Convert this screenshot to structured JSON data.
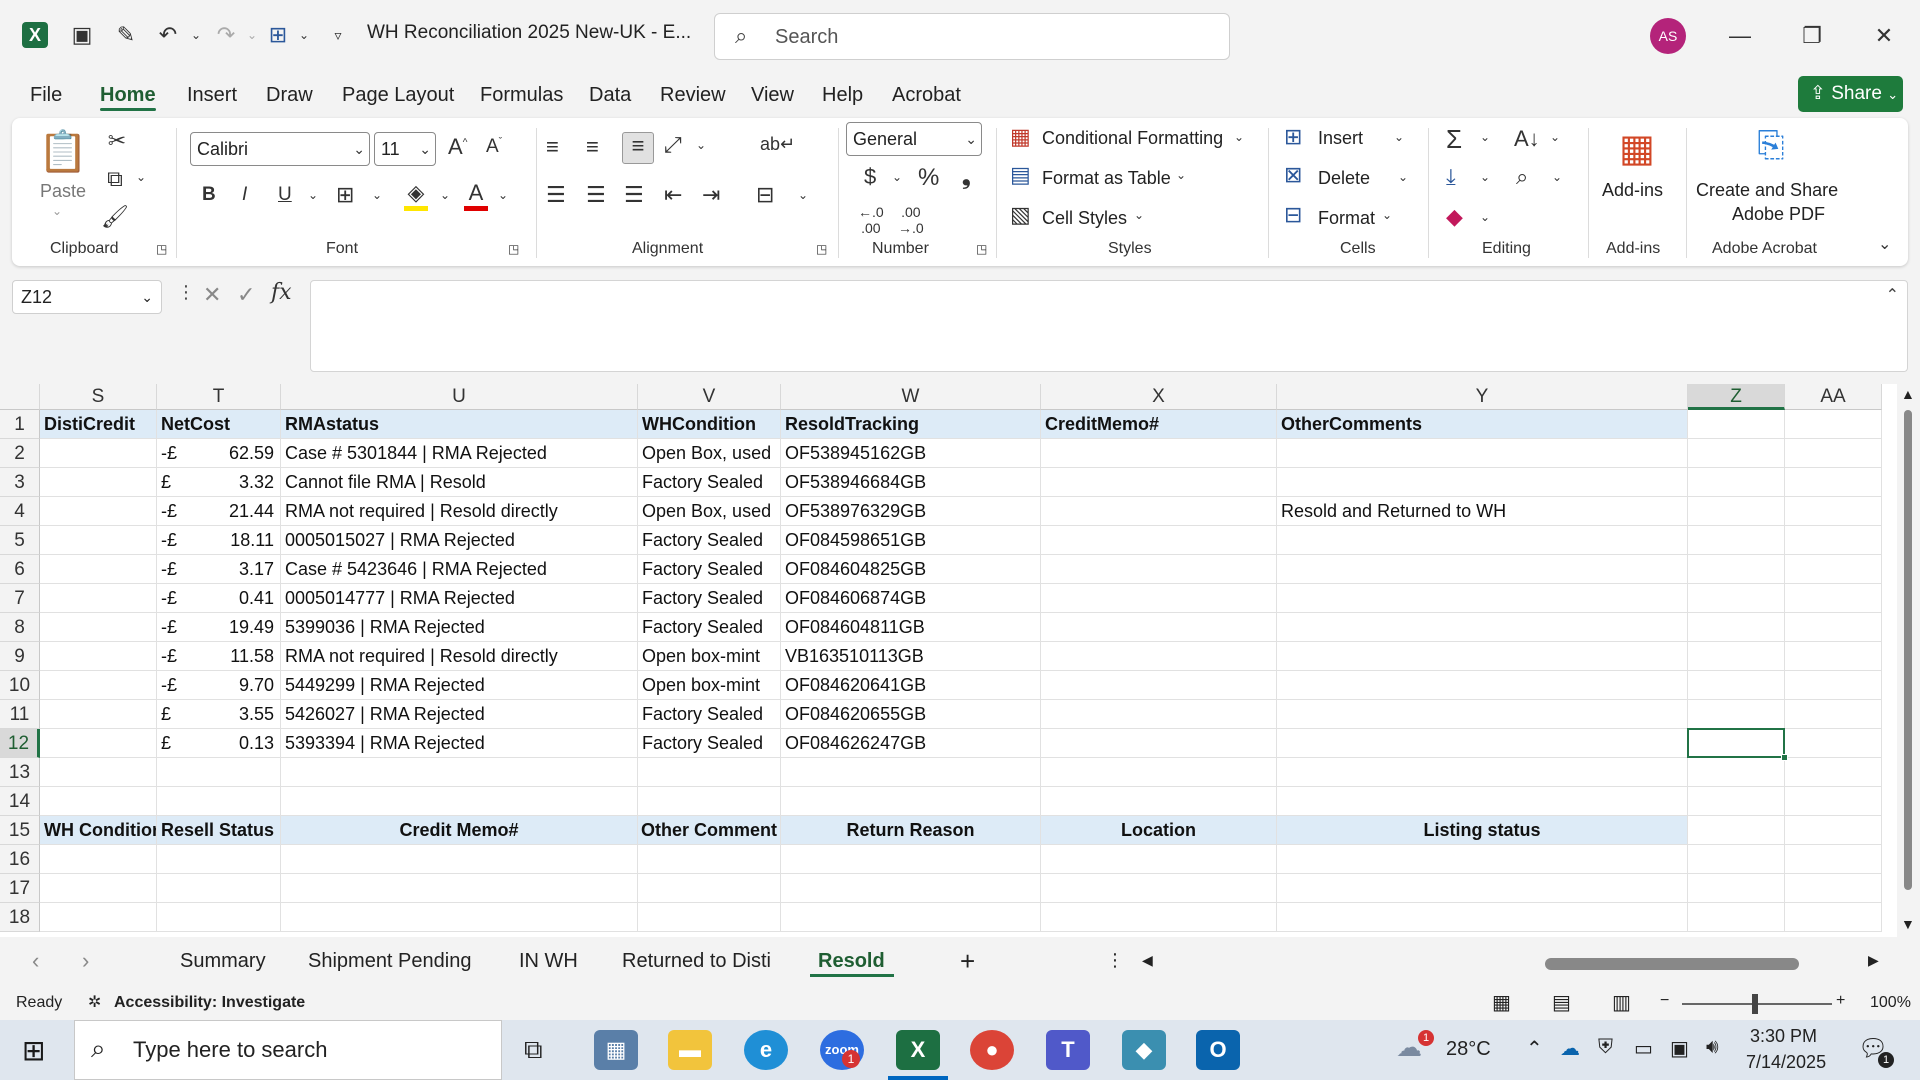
{
  "title_bar": {
    "document_title": "WH Reconciliation 2025 New-UK  -  E...",
    "search_placeholder": "Search",
    "user_initials": "AS"
  },
  "menu": {
    "items": [
      "File",
      "Home",
      "Insert",
      "Draw",
      "Page Layout",
      "Formulas",
      "Data",
      "Review",
      "View",
      "Help",
      "Acrobat"
    ],
    "active": "Home",
    "share_label": "Share"
  },
  "ribbon": {
    "clipboard": {
      "label": "Clipboard",
      "paste": "Paste"
    },
    "font": {
      "label": "Font",
      "font_name": "Calibri",
      "font_size": "11"
    },
    "alignment": {
      "label": "Alignment"
    },
    "number": {
      "label": "Number",
      "format": "General"
    },
    "styles": {
      "label": "Styles",
      "conditional": "Conditional Formatting",
      "format_table": "Format as Table",
      "cell_styles": "Cell Styles"
    },
    "cells": {
      "label": "Cells",
      "insert": "Insert",
      "delete": "Delete",
      "format": "Format"
    },
    "editing": {
      "label": "Editing"
    },
    "addins": {
      "label": "Add-ins",
      "button": "Add-ins"
    },
    "acrobat": {
      "label": "Adobe Acrobat",
      "button_line1": "Create and Share",
      "button_line2": "Adobe PDF"
    }
  },
  "formula_bar": {
    "name_box": "Z12",
    "fx": "fx"
  },
  "grid": {
    "columns": [
      "S",
      "T",
      "U",
      "V",
      "W",
      "X",
      "Y",
      "Z",
      "AA"
    ],
    "selected_column": "Z",
    "selected_row": "12",
    "header_row": [
      "DistiCredit",
      "NetCost",
      "RMAstatus",
      "WHCondition",
      "ResoldTracking",
      "CreditMemo#",
      "OtherComments"
    ],
    "rows": [
      {
        "n": "2",
        "sign": "-£",
        "amt": "62.59",
        "status": "Case # 5301844 | RMA Rejected",
        "cond": "Open Box, used",
        "track": "OF538945162GB",
        "comment": ""
      },
      {
        "n": "3",
        "sign": "£",
        "amt": "3.32",
        "status": "Cannot file RMA | Resold",
        "cond": "Factory Sealed",
        "track": "OF538946684GB",
        "comment": ""
      },
      {
        "n": "4",
        "sign": "-£",
        "amt": "21.44",
        "status": "RMA not required | Resold directly",
        "cond": "Open Box, used",
        "track": "OF538976329GB",
        "comment": "Resold and Returned to WH"
      },
      {
        "n": "5",
        "sign": "-£",
        "amt": "18.11",
        "status": "0005015027 | RMA Rejected",
        "cond": "Factory Sealed",
        "track": "OF084598651GB",
        "comment": ""
      },
      {
        "n": "6",
        "sign": "-£",
        "amt": "3.17",
        "status": "Case # 5423646 | RMA Rejected",
        "cond": "Factory Sealed",
        "track": "OF084604825GB",
        "comment": ""
      },
      {
        "n": "7",
        "sign": "-£",
        "amt": "0.41",
        "status": "0005014777 | RMA Rejected",
        "cond": "Factory Sealed",
        "track": "OF084606874GB",
        "comment": ""
      },
      {
        "n": "8",
        "sign": "-£",
        "amt": "19.49",
        "status": "5399036 | RMA Rejected",
        "cond": "Factory Sealed",
        "track": "OF084604811GB",
        "comment": ""
      },
      {
        "n": "9",
        "sign": "-£",
        "amt": "11.58",
        "status": "RMA not required | Resold directly",
        "cond": "Open box-mint",
        "track": "VB163510113GB",
        "comment": ""
      },
      {
        "n": "10",
        "sign": "-£",
        "amt": "9.70",
        "status": "5449299 | RMA Rejected",
        "cond": "Open box-mint",
        "track": "OF084620641GB",
        "comment": ""
      },
      {
        "n": "11",
        "sign": "£",
        "amt": "3.55",
        "status": "5426027 | RMA Rejected",
        "cond": "Factory Sealed",
        "track": "OF084620655GB",
        "comment": ""
      },
      {
        "n": "12",
        "sign": "£",
        "amt": "0.13",
        "status": "5393394 | RMA Rejected",
        "cond": "Factory Sealed",
        "track": "OF084626247GB",
        "comment": ""
      }
    ],
    "empty_rows_a": [
      "13",
      "14"
    ],
    "header2_row": {
      "n": "15",
      "cells": [
        "WH Conditior",
        "Resell Status",
        "Credit Memo#",
        "Other Comment",
        "Return Reason",
        "Location",
        "Listing status"
      ]
    },
    "empty_rows_b": [
      "16",
      "17",
      "18"
    ],
    "row1_num": "1"
  },
  "sheet_tabs": {
    "tabs": [
      "Summary",
      "Shipment Pending",
      "IN WH",
      "Returned to Disti",
      "Resold"
    ],
    "active": "Resold"
  },
  "status_bar": {
    "ready": "Ready",
    "accessibility": "Accessibility: Investigate",
    "zoom": "100%"
  },
  "taskbar": {
    "search_placeholder": "Type here to search",
    "weather": "28°C",
    "time": "3:30 PM",
    "date": "7/14/2025",
    "notif_count": "1",
    "teams_badge": "1"
  },
  "colors": {
    "excel_green": "#217346",
    "header_fill": "#ddebf7",
    "avatar": "#b4237a"
  }
}
